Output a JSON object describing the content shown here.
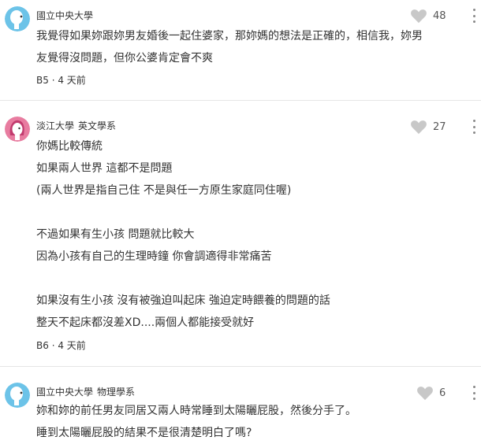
{
  "comments": [
    {
      "author": "國立中央大學",
      "department": "",
      "likes": "48",
      "lines": [
        "我覺得如果妳跟妳男友婚後一起住婆家，那妳媽的想法是正確的，相信我，妳男",
        "友覺得沒問題，但你公婆肯定會不爽"
      ],
      "floor": "B5",
      "time": "4 天前",
      "avatar_color": "#6cc3e8"
    },
    {
      "author": "淡江大學",
      "department": "英文學系",
      "likes": "27",
      "lines": [
        "你媽比較傳統",
        "如果兩人世界 這都不是問題",
        "(兩人世界是指自己住 不是與任一方原生家庭同住喔)",
        "",
        "不過如果有生小孩 問題就比較大",
        "因為小孩有自己的生理時鐘 你會調適得非常痛苦",
        "",
        "如果沒有生小孩 沒有被強迫叫起床 強迫定時餵養的問題的話",
        "整天不起床都沒差XD....兩個人都能接受就好"
      ],
      "floor": "B6",
      "time": "4 天前",
      "avatar_color": "#e87ca0"
    },
    {
      "author": "國立中央大學",
      "department": "物理學系",
      "likes": "6",
      "lines": [
        "妳和妳的前任男友同居又兩人時常睡到太陽曬屁股，然後分手了。",
        "睡到太陽曬屁股的結果不是很清楚明白了嗎?"
      ],
      "floor": "",
      "time": "",
      "avatar_color": "#6cc3e8"
    }
  ],
  "icons": {
    "like": "heart-icon",
    "more": "more-vertical-icon",
    "avatar": "user-avatar"
  },
  "colors": {
    "heart": "#c8c8c8",
    "divider": "#e5e5e5",
    "avatar_blue": "#6cc3e8",
    "avatar_pink": "#e87ca0"
  }
}
